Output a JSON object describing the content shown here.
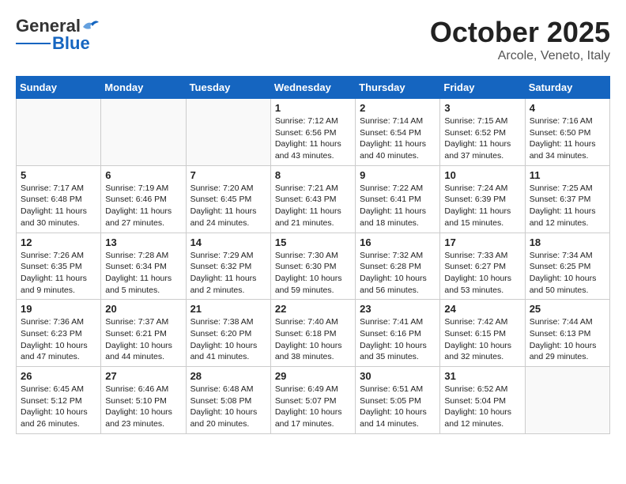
{
  "header": {
    "logo_general": "General",
    "logo_blue": "Blue",
    "month": "October 2025",
    "location": "Arcole, Veneto, Italy"
  },
  "weekdays": [
    "Sunday",
    "Monday",
    "Tuesday",
    "Wednesday",
    "Thursday",
    "Friday",
    "Saturday"
  ],
  "weeks": [
    [
      {
        "day": "",
        "info": ""
      },
      {
        "day": "",
        "info": ""
      },
      {
        "day": "",
        "info": ""
      },
      {
        "day": "1",
        "info": "Sunrise: 7:12 AM\nSunset: 6:56 PM\nDaylight: 11 hours and 43 minutes."
      },
      {
        "day": "2",
        "info": "Sunrise: 7:14 AM\nSunset: 6:54 PM\nDaylight: 11 hours and 40 minutes."
      },
      {
        "day": "3",
        "info": "Sunrise: 7:15 AM\nSunset: 6:52 PM\nDaylight: 11 hours and 37 minutes."
      },
      {
        "day": "4",
        "info": "Sunrise: 7:16 AM\nSunset: 6:50 PM\nDaylight: 11 hours and 34 minutes."
      }
    ],
    [
      {
        "day": "5",
        "info": "Sunrise: 7:17 AM\nSunset: 6:48 PM\nDaylight: 11 hours and 30 minutes."
      },
      {
        "day": "6",
        "info": "Sunrise: 7:19 AM\nSunset: 6:46 PM\nDaylight: 11 hours and 27 minutes."
      },
      {
        "day": "7",
        "info": "Sunrise: 7:20 AM\nSunset: 6:45 PM\nDaylight: 11 hours and 24 minutes."
      },
      {
        "day": "8",
        "info": "Sunrise: 7:21 AM\nSunset: 6:43 PM\nDaylight: 11 hours and 21 minutes."
      },
      {
        "day": "9",
        "info": "Sunrise: 7:22 AM\nSunset: 6:41 PM\nDaylight: 11 hours and 18 minutes."
      },
      {
        "day": "10",
        "info": "Sunrise: 7:24 AM\nSunset: 6:39 PM\nDaylight: 11 hours and 15 minutes."
      },
      {
        "day": "11",
        "info": "Sunrise: 7:25 AM\nSunset: 6:37 PM\nDaylight: 11 hours and 12 minutes."
      }
    ],
    [
      {
        "day": "12",
        "info": "Sunrise: 7:26 AM\nSunset: 6:35 PM\nDaylight: 11 hours and 9 minutes."
      },
      {
        "day": "13",
        "info": "Sunrise: 7:28 AM\nSunset: 6:34 PM\nDaylight: 11 hours and 5 minutes."
      },
      {
        "day": "14",
        "info": "Sunrise: 7:29 AM\nSunset: 6:32 PM\nDaylight: 11 hours and 2 minutes."
      },
      {
        "day": "15",
        "info": "Sunrise: 7:30 AM\nSunset: 6:30 PM\nDaylight: 10 hours and 59 minutes."
      },
      {
        "day": "16",
        "info": "Sunrise: 7:32 AM\nSunset: 6:28 PM\nDaylight: 10 hours and 56 minutes."
      },
      {
        "day": "17",
        "info": "Sunrise: 7:33 AM\nSunset: 6:27 PM\nDaylight: 10 hours and 53 minutes."
      },
      {
        "day": "18",
        "info": "Sunrise: 7:34 AM\nSunset: 6:25 PM\nDaylight: 10 hours and 50 minutes."
      }
    ],
    [
      {
        "day": "19",
        "info": "Sunrise: 7:36 AM\nSunset: 6:23 PM\nDaylight: 10 hours and 47 minutes."
      },
      {
        "day": "20",
        "info": "Sunrise: 7:37 AM\nSunset: 6:21 PM\nDaylight: 10 hours and 44 minutes."
      },
      {
        "day": "21",
        "info": "Sunrise: 7:38 AM\nSunset: 6:20 PM\nDaylight: 10 hours and 41 minutes."
      },
      {
        "day": "22",
        "info": "Sunrise: 7:40 AM\nSunset: 6:18 PM\nDaylight: 10 hours and 38 minutes."
      },
      {
        "day": "23",
        "info": "Sunrise: 7:41 AM\nSunset: 6:16 PM\nDaylight: 10 hours and 35 minutes."
      },
      {
        "day": "24",
        "info": "Sunrise: 7:42 AM\nSunset: 6:15 PM\nDaylight: 10 hours and 32 minutes."
      },
      {
        "day": "25",
        "info": "Sunrise: 7:44 AM\nSunset: 6:13 PM\nDaylight: 10 hours and 29 minutes."
      }
    ],
    [
      {
        "day": "26",
        "info": "Sunrise: 6:45 AM\nSunset: 5:12 PM\nDaylight: 10 hours and 26 minutes."
      },
      {
        "day": "27",
        "info": "Sunrise: 6:46 AM\nSunset: 5:10 PM\nDaylight: 10 hours and 23 minutes."
      },
      {
        "day": "28",
        "info": "Sunrise: 6:48 AM\nSunset: 5:08 PM\nDaylight: 10 hours and 20 minutes."
      },
      {
        "day": "29",
        "info": "Sunrise: 6:49 AM\nSunset: 5:07 PM\nDaylight: 10 hours and 17 minutes."
      },
      {
        "day": "30",
        "info": "Sunrise: 6:51 AM\nSunset: 5:05 PM\nDaylight: 10 hours and 14 minutes."
      },
      {
        "day": "31",
        "info": "Sunrise: 6:52 AM\nSunset: 5:04 PM\nDaylight: 10 hours and 12 minutes."
      },
      {
        "day": "",
        "info": ""
      }
    ]
  ]
}
